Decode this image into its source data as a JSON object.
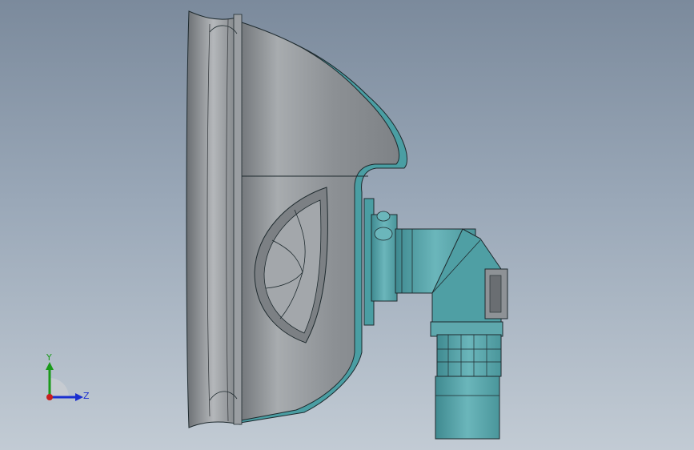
{
  "triad": {
    "y_label": "Y",
    "z_label": "Z",
    "y_color": "#1a9a1a",
    "z_color": "#1a2fd0",
    "origin_color": "#c81e1e"
  },
  "colors": {
    "background_top": "#7b8a9c",
    "background_bottom": "#c2cbd4",
    "shell_gray": "#8e9296",
    "shell_light": "#b9bcbf",
    "teal": "#5fa9ae",
    "teal_dark": "#3f8a90",
    "outline": "#1e2a2e"
  },
  "icons": {
    "view_triad": "reference-triad-icon",
    "model": "mask-assembly-model"
  }
}
